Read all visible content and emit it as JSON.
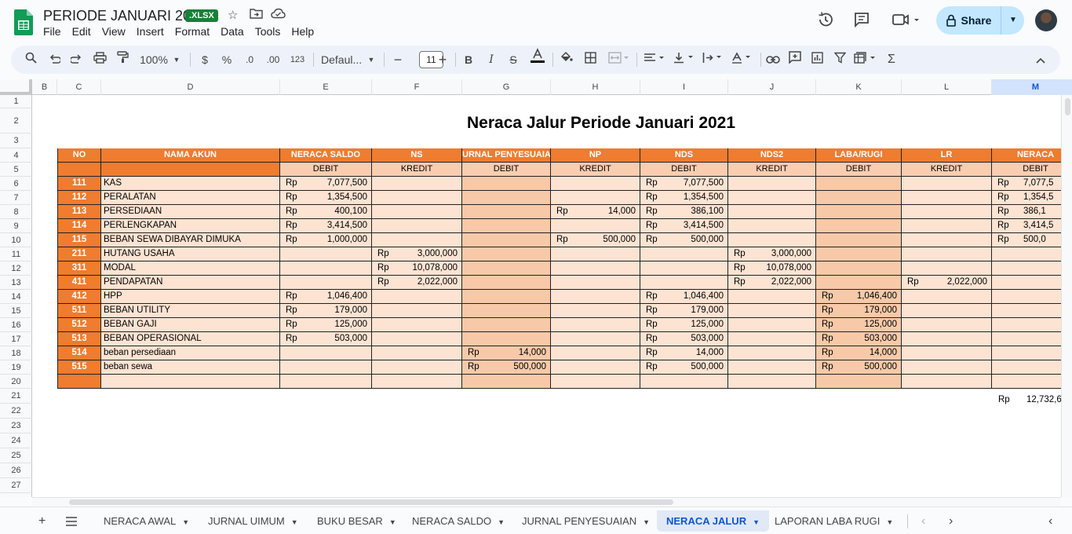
{
  "doc": {
    "title": "PERIODE JANUARI 2021",
    "badge": ".XLSX"
  },
  "menu": [
    "File",
    "Edit",
    "View",
    "Insert",
    "Format",
    "Data",
    "Tools",
    "Help"
  ],
  "share": {
    "label": "Share"
  },
  "toolbar": {
    "zoom": "100%",
    "currency": "$",
    "percent": "%",
    "dec_dec": ".0",
    "dec_inc": ".00",
    "num_format": "123",
    "font": "Defaul...",
    "font_size": "11"
  },
  "columns": [
    "B",
    "C",
    "D",
    "E",
    "F",
    "G",
    "H",
    "I",
    "J",
    "K",
    "L",
    "M"
  ],
  "rows": [
    "1",
    "2",
    "3",
    "4",
    "5",
    "6",
    "7",
    "8",
    "9",
    "10",
    "11",
    "12",
    "13",
    "14",
    "15",
    "16",
    "17",
    "18",
    "19",
    "20",
    "21",
    "22",
    "23",
    "24",
    "25",
    "26",
    "27"
  ],
  "sheet": {
    "title": "Neraca Jalur Periode Januari 2021",
    "header1": [
      "NO",
      "NAMA AKUN",
      "NERACA SALDO",
      "NS",
      "URNAL PENYESUAIA",
      "NP",
      "NDS",
      "NDS2",
      "LABA/RUGI",
      "LR",
      "NERACA"
    ],
    "header2": [
      "DEBIT",
      "KREDIT",
      "DEBIT",
      "KREDIT",
      "DEBIT",
      "KREDIT",
      "DEBIT",
      "KREDIT",
      "DEBIT"
    ],
    "currency": "Rp",
    "rows": [
      {
        "no": "111",
        "name": "KAS",
        "v": [
          "7,077,500",
          "",
          "",
          "",
          "7,077,500",
          "",
          "",
          "",
          "7,077,5"
        ]
      },
      {
        "no": "112",
        "name": "PERALATAN",
        "v": [
          "1,354,500",
          "",
          "",
          "",
          "1,354,500",
          "",
          "",
          "",
          "1,354,5"
        ]
      },
      {
        "no": "113",
        "name": "PERSEDIAAN",
        "v": [
          "400,100",
          "",
          "",
          "14,000",
          "386,100",
          "",
          "",
          "",
          "386,1"
        ]
      },
      {
        "no": "114",
        "name": "PERLENGKAPAN",
        "v": [
          "3,414,500",
          "",
          "",
          "",
          "3,414,500",
          "",
          "",
          "",
          "3,414,5"
        ]
      },
      {
        "no": "115",
        "name": "BEBAN SEWA DIBAYAR DIMUKA",
        "v": [
          "1,000,000",
          "",
          "",
          "500,000",
          "500,000",
          "",
          "",
          "",
          "500,0"
        ]
      },
      {
        "no": "211",
        "name": "HUTANG USAHA",
        "v": [
          "",
          "3,000,000",
          "",
          "",
          "",
          "3,000,000",
          "",
          "",
          ""
        ]
      },
      {
        "no": "311",
        "name": "MODAL",
        "v": [
          "",
          "10,078,000",
          "",
          "",
          "",
          "10,078,000",
          "",
          "",
          ""
        ]
      },
      {
        "no": "411",
        "name": "PENDAPATAN",
        "v": [
          "",
          "2,022,000",
          "",
          "",
          "",
          "2,022,000",
          "",
          "2,022,000",
          ""
        ]
      },
      {
        "no": "412",
        "name": "HPP",
        "v": [
          "1,046,400",
          "",
          "",
          "",
          "1,046,400",
          "",
          "1,046,400",
          "",
          ""
        ]
      },
      {
        "no": "511",
        "name": "BEBAN UTILITY",
        "v": [
          "179,000",
          "",
          "",
          "",
          "179,000",
          "",
          "179,000",
          "",
          ""
        ]
      },
      {
        "no": "512",
        "name": "BEBAN GAJI",
        "v": [
          "125,000",
          "",
          "",
          "",
          "125,000",
          "",
          "125,000",
          "",
          ""
        ]
      },
      {
        "no": "513",
        "name": "BEBAN OPERASIONAL",
        "v": [
          "503,000",
          "",
          "",
          "",
          "503,000",
          "",
          "503,000",
          "",
          ""
        ]
      },
      {
        "no": "514",
        "name": "beban persediaan",
        "v": [
          "",
          "",
          "14,000",
          "",
          "14,000",
          "",
          "14,000",
          "",
          ""
        ]
      },
      {
        "no": "515",
        "name": "beban sewa",
        "v": [
          "",
          "",
          "500,000",
          "",
          "500,000",
          "",
          "500,000",
          "",
          ""
        ]
      },
      {
        "no": "",
        "name": "",
        "v": [
          "",
          "",
          "",
          "",
          "",
          "",
          "",
          "",
          ""
        ]
      }
    ],
    "total": {
      "currency": "Rp",
      "amount": "12,732,6"
    }
  },
  "tabs": [
    "NERACA AWAL",
    "JURNAL UIMUM",
    "BUKU BESAR",
    "NERACA SALDO",
    "JURNAL PENYESUAIAN",
    "NERACA JALUR",
    "LAPORAN LABA RUGI"
  ],
  "active_tab": "NERACA JALUR"
}
